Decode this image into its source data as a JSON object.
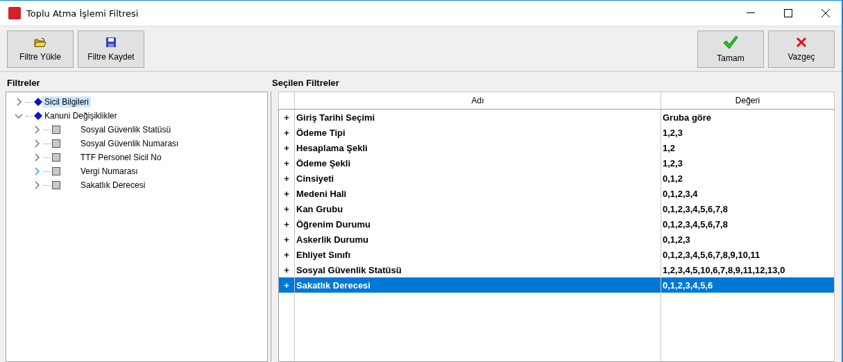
{
  "window": {
    "title": "Toplu Atma İşlemi Filtresi"
  },
  "toolbar_left": [
    {
      "label": "Filtre Yükle",
      "kind": "open"
    },
    {
      "label": "Filtre Kaydet",
      "kind": "save"
    }
  ],
  "toolbar_right": [
    {
      "label": "Tamam",
      "kind": "ok"
    },
    {
      "label": "Vazgeç",
      "kind": "cancel"
    }
  ],
  "filters": {
    "title": "Filtreler",
    "tree": [
      {
        "label": "Sicil Bilgileri",
        "selected": true,
        "expanded": false,
        "hot": false,
        "kind": "group"
      },
      {
        "label": "Kanuni Değişiklikler",
        "selected": false,
        "expanded": true,
        "hot": false,
        "kind": "group",
        "children": [
          {
            "label": "Sosyal Güvenlik Statüsü",
            "selected": false,
            "expanded": false,
            "hot": false,
            "kind": "item"
          },
          {
            "label": "Sosyal Güvenlik Numarası",
            "selected": false,
            "expanded": false,
            "hot": false,
            "kind": "item"
          },
          {
            "label": "TTF Personel Sicil No",
            "selected": false,
            "expanded": false,
            "hot": false,
            "kind": "item"
          },
          {
            "label": "Vergi Numarası",
            "selected": false,
            "expanded": false,
            "hot": true,
            "kind": "item"
          },
          {
            "label": "Sakatlık Derecesi",
            "selected": false,
            "expanded": false,
            "hot": false,
            "kind": "item"
          }
        ]
      }
    ]
  },
  "selected_filters": {
    "title": "Seçilen Filtreler",
    "columns": [
      "Adı",
      "Değeri"
    ],
    "rows": [
      {
        "expander": "+",
        "name": "Giriş Tarihi Seçimi",
        "value": "Gruba göre",
        "selected": false
      },
      {
        "expander": "+",
        "name": "Ödeme Tipi",
        "value": "1,2,3",
        "selected": false
      },
      {
        "expander": "+",
        "name": "Hesaplama Şekli",
        "value": "1,2",
        "selected": false
      },
      {
        "expander": "+",
        "name": "Ödeme Şekli",
        "value": "1,2,3",
        "selected": false
      },
      {
        "expander": "+",
        "name": "Cinsiyeti",
        "value": "0,1,2",
        "selected": false
      },
      {
        "expander": "+",
        "name": "Medeni Hali",
        "value": "0,1,2,3,4",
        "selected": false
      },
      {
        "expander": "+",
        "name": "Kan Grubu",
        "value": "0,1,2,3,4,5,6,7,8",
        "selected": false
      },
      {
        "expander": "+",
        "name": "Öğrenim Durumu",
        "value": "0,1,2,3,4,5,6,7,8",
        "selected": false
      },
      {
        "expander": "+",
        "name": "Askerlik Durumu",
        "value": "0,1,2,3",
        "selected": false
      },
      {
        "expander": "+",
        "name": "Ehliyet Sınıfı",
        "value": "0,1,2,3,4,5,6,7,8,9,10,11",
        "selected": false
      },
      {
        "expander": "+",
        "name": "Sosyal Güvenlik Statüsü",
        "value": "1,2,3,4,5,10,6,7,8,9,11,12,13,0",
        "selected": false
      },
      {
        "expander": "+",
        "name": "Sakatlık Derecesi",
        "value": "0,1,2,3,4,5,6",
        "selected": true
      }
    ]
  }
}
